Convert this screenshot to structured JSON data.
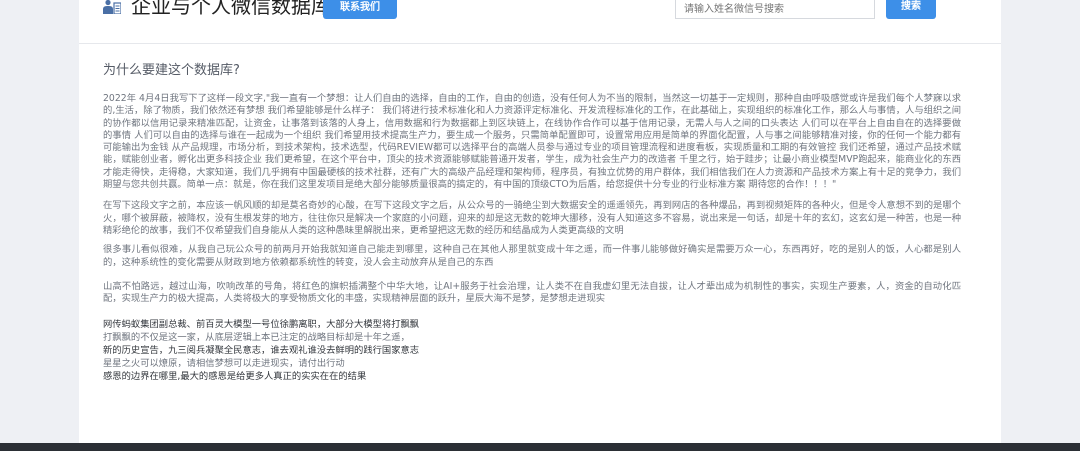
{
  "header": {
    "logo_icon": "database-icon",
    "site_title": "企业与个人微信数据库",
    "contact_label": "联系我们",
    "search_placeholder": "请输入姓名微信号搜索",
    "search_label": "搜索"
  },
  "colors": {
    "accent": "#3d8fe8",
    "title_text": "#222222",
    "body_text": "#6f757f",
    "strong_text": "#33373d",
    "footer_bar": "#2b2f35"
  },
  "main": {
    "section_title": "为什么要建这个数据库?",
    "paragraphs": [
      "2022年 4月4日我写下了这样一段文字,\"我一直有一个梦想：让人们自由的选择，自由的工作，自由的创造，没有任何人为不当的限制，当然这一切基于一定规则，那种自由呼吸感觉或许是我们每个人梦寐以求的,生活，除了物质，我们依然还有梦想 我们希望能够是什么样子： 我们将进行技术标准化和人力资源评定标准化、开发流程标准化的工作，在此基础上，实现组织的标准化工作，那么人与事情，人与组织之间的协作都以信用记录来精准匹配，让资金，让事落到该落的人身上，信用数据和行为数据都上到区块链上，在线协作合作可以基于信用记录，无需人与人之间的口头表达 人们可以在平台上自由自在的选择要做的事情 人们可以自由的选择与谁在一起成为一个组织 我们希望用技术提高生产力，要生成一个服务，只需简单配置即可，设置常用应用是简单的界面化配置，人与事之间能够精准对接，你的任何一个能力都有可能输出为金钱 从产品规理，市场分析，到技术架构，技术选型，代码REVIEW都可以选择平台的高端人员参与通过专业的项目管理流程和进度看板，实现质量和工期的有效管控 我们还希望，通过产品技术赋能，赋能创业者，孵化出更多科技企业 我们更希望，在这个平台中，顶尖的技术资源能够赋能普通开发者，学生，成为社会生产力的改造者 千里之行，始于跬步；让最小商业模型MVP跑起来，能商业化的东西才能走得快，走得稳，大家知道，我们几乎拥有中国最硬核的技术社群，还有广大的高级产品经理和架构师，程序员，有独立优势的用户群体，我们相信我们在人力资源和产品技术方案上有十足的竞争力，我们期望与您共创共赢。简单一点：就是，你在我们这里发项目是绝大部分能够质量很高的搞定的，有中国的顶级CTO为后盾，给您提供十分专业的行业标准方案 期待您的合作！！！\"",
      "在写下这段文字之前，本应该一帆风顺的却是莫名奇妙的心酸，在写下这段文字之后，从公众号的一骑绝尘到大数据安全的遥遥领先，再到网店的各种爆品，再到视频矩阵的各种火，但是令人意想不到的是哪个火，哪个被屏蔽，被降权，没有生根发芽的地方，往往你只是解决一个家庭的小问题，迎来的却是这无数的乾坤大挪移，没有人知道这多不容易，说出来是一句话，却是十年的玄幻，这玄幻是一种苦，也是一种精彩绝伦的故事，我们不仅希望我们自身能从人类的这种愚昧里解脱出来，更希望把这无数的经历和结晶成为人类更高级的文明",
      "很多事儿看似很难，从我自己玩公众号的前两月开始我就知道自己能走到哪里，这种自己在其他人那里就变成十年之遥，而一件事儿能够做好确实是需要万众一心，东西再好，吃的是别人的饭，人心都是别人的，这种系统性的变化需要从财政到地方依赖都系统性的转变，没人会主动放弃从是自己的东西",
      "山高不怕路远，越过山海，吹响改革的号角，将红色的旗帜插满整个中华大地，让AI+服务于社会治理，让人类不在自我虚幻里无法自拔，让人才辈出成为机制性的事实，实现生产要素，人，资金的自动化匹配，实现生产力的极大提高，人类将极大的享受物质文化的丰盛，实现精神层面的跃升，星辰大海不是梦，是梦想走进现实"
    ],
    "poem": [
      "网传蚂蚁集团副总裁、前百灵大模型一号位徐鹏离职，大部分大模型将打飘飘",
      "打飘飘的不仅是这一家，从底层逻辑上本已注定的战略目标却是十年之遥，",
      "新的历史宣告，九三阅兵凝聚全民意志，谁去观礼谁没去鲜明的践行国家意志",
      "星星之火可以燎原，请相信梦想可以走进现实，请付出行动",
      "感恩的边界在哪里,最大的感恩是给更多人真正的实实在在的结果"
    ]
  }
}
